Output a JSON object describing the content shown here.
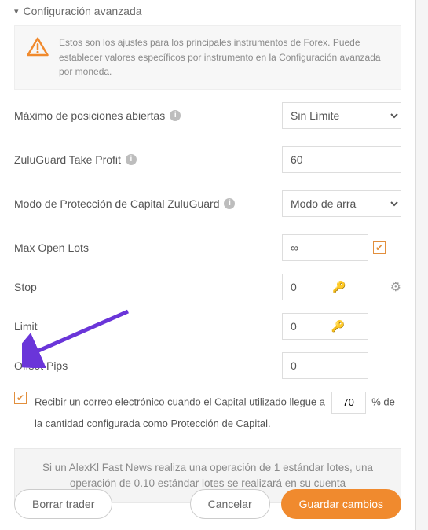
{
  "section": {
    "title": "Configuración avanzada"
  },
  "banner": {
    "text": "Estos son los ajustes para los principales instrumentos de Forex. Puede establecer valores específicos por instrumento en la Configuración avanzada por moneda."
  },
  "fields": {
    "maxOpen": {
      "label": "Máximo de posiciones abiertas",
      "value": "Sin Límite"
    },
    "zgTakeProfit": {
      "label": "ZuluGuard Take Profit",
      "value": "60"
    },
    "zgCapMode": {
      "label": "Modo de Protección de Capital ZuluGuard",
      "value": "Modo de arra"
    },
    "maxOpenLots": {
      "label": "Max Open Lots",
      "value": "∞"
    },
    "stop": {
      "label": "Stop",
      "value": "0"
    },
    "limit": {
      "label": "Limit",
      "value": "0"
    },
    "offset": {
      "label": "Offset Pips",
      "value": "0"
    }
  },
  "emailNotice": {
    "prefix": "Recibir un correo electrónico cuando el Capital utilizado llegue a",
    "value": "70",
    "suffix": "% de la cantidad configurada como Protección de Capital."
  },
  "note": {
    "text": "Si un AlexKl Fast News realiza una operación de 1 estándar lotes, una operación de 0.10 estándar lotes se realizará en su cuenta"
  },
  "buttons": {
    "delete": "Borrar trader",
    "cancel": "Cancelar",
    "save": "Guardar cambios"
  }
}
